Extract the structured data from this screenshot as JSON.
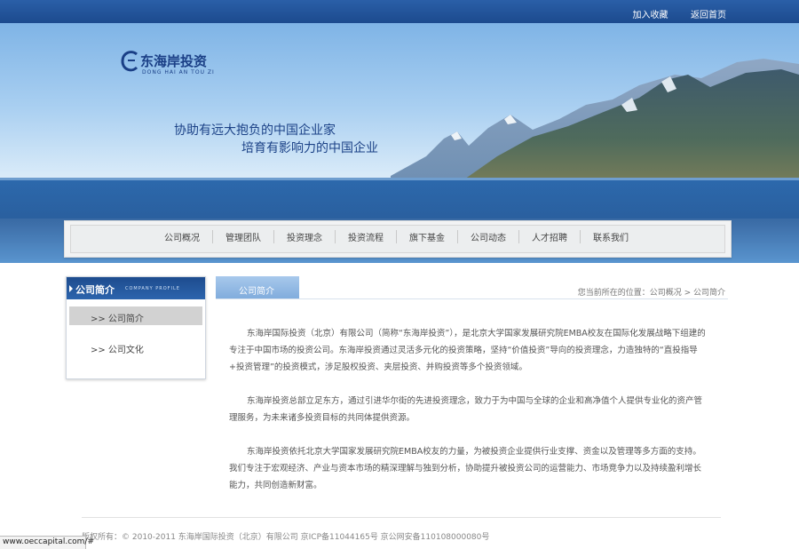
{
  "topbar": {
    "favorite": "加入收藏",
    "home": "返回首页"
  },
  "logo": {
    "cn": "东海岸投资",
    "en": "DONG HAI AN TOU ZI"
  },
  "banner": {
    "slogan_line1": "协助有远大抱负的中国企业家",
    "slogan_line2": "培育有影响力的中国企业"
  },
  "nav": [
    "公司概况",
    "管理团队",
    "投资理念",
    "投资流程",
    "旗下基金",
    "公司动态",
    "人才招聘",
    "联系我们"
  ],
  "sidebar": {
    "title_cn": "公司简介",
    "title_en": "COMPANY PROFILE",
    "items": [
      {
        "label": ">> 公司简介",
        "active": true
      },
      {
        "label": ">> 公司文化",
        "active": false
      }
    ]
  },
  "content": {
    "tab": "公司简介",
    "breadcrumb": "您当前所在的位置：公司概况 > 公司简介",
    "paragraphs": [
      "东海岸国际投资（北京）有限公司（简称“东海岸投资”），是北京大学国家发展研究院EMBA校友在国际化发展战略下组建的专注于中国市场的投资公司。东海岸投资通过灵活多元化的投资策略，坚持“价值投资”导向的投资理念，力造独特的“直投指导+投资管理”的投资模式，涉足股权投资、夹层投资、并购投资等多个投资领域。",
      "东海岸投资总部立足东方，通过引进华尔街的先进投资理念，致力于为中国与全球的企业和高净值个人提供专业化的资产管理服务，为未来诸多投资目标的共同体提供资源。",
      "东海岸投资依托北京大学国家发展研究院EMBA校友的力量，为被投资企业提供行业支撑、资金以及管理等多方面的支持。我们专注于宏观经济、产业与资本市场的精深理解与独到分析，协助提升被投资公司的运营能力、市场竞争力以及持续盈利增长能力，共同创造新财富。"
    ]
  },
  "footer": {
    "text": "版权所有：© 2010-2011 东海岸国际投资（北京）有限公司 京ICP备11044165号 京公网安备110108000080号"
  },
  "statusbar": {
    "url": "www.oeccapital.com/#"
  }
}
